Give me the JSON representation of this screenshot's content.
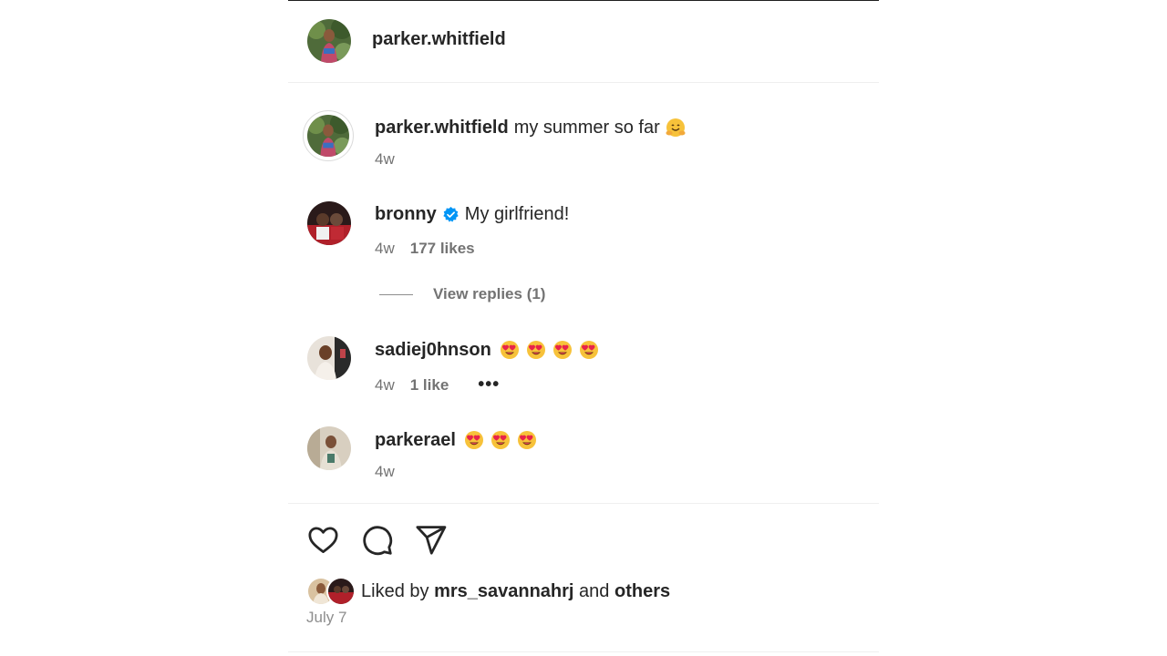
{
  "header": {
    "username": "parker.whitfield"
  },
  "caption": {
    "username": "parker.whitfield",
    "text": "my summer so far",
    "emoji": "hugging-face-emoji",
    "time": "4w"
  },
  "comments": [
    {
      "username": "bronny",
      "verified": true,
      "text": "My girlfriend!",
      "time": "4w",
      "likes": "177 likes"
    },
    {
      "username": "sadiej0hnson",
      "emoji_count": 4,
      "emoji": "heart-eyes-emoji",
      "time": "4w",
      "likes": "1 like",
      "more": "•••"
    },
    {
      "username": "parkerael",
      "emoji_count": 3,
      "emoji": "heart-eyes-emoji",
      "time": "4w"
    }
  ],
  "replies": {
    "label": "View replies (1)"
  },
  "actions": {
    "like_icon": "heart-icon",
    "comment_icon": "comment-icon",
    "share_icon": "share-icon"
  },
  "liked_by": {
    "prefix": "Liked by",
    "user": "mrs_savannahrj",
    "joiner": "and",
    "others": "others"
  },
  "post_date": "July 7",
  "colors": {
    "verified_blue": "#0095f6",
    "muted_text": "#737373",
    "divider": "#efefef"
  }
}
